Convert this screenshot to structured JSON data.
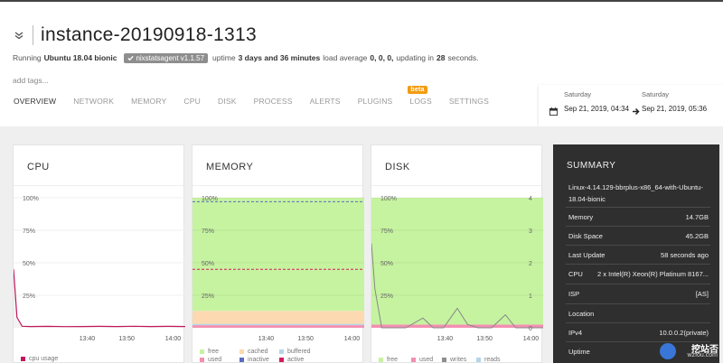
{
  "header": {
    "title": "instance-20190918-1313",
    "running_prefix": "Running",
    "os": "Ubuntu 18.04 bionic",
    "agent_badge": "nixstatsagent v1.1.57",
    "uptime_prefix": "uptime",
    "uptime_value": "3 days and 36 minutes",
    "load_prefix": "load average",
    "load_value": "0, 0, 0,",
    "updating_prefix": "updating in",
    "updating_value": "28",
    "updating_suffix": "seconds.",
    "add_tags": "add tags..."
  },
  "tabs": [
    {
      "label": "OVERVIEW",
      "active": true
    },
    {
      "label": "NETWORK"
    },
    {
      "label": "MEMORY"
    },
    {
      "label": "CPU"
    },
    {
      "label": "DISK"
    },
    {
      "label": "PROCESS"
    },
    {
      "label": "ALERTS"
    },
    {
      "label": "PLUGINS"
    },
    {
      "label": "LOGS",
      "badge": "beta"
    },
    {
      "label": "SETTINGS"
    }
  ],
  "date_range": {
    "from_day": "Saturday",
    "from_date": "Sep 21, 2019, 04:34",
    "to_day": "Saturday",
    "to_date": "Sep 21, 2019, 05:36"
  },
  "cards": {
    "cpu": {
      "title": "CPU",
      "legend": [
        "cpu usage"
      ]
    },
    "memory": {
      "title": "MEMORY",
      "legend": [
        "free",
        "cached",
        "buffered",
        "used",
        "inactive",
        "active"
      ]
    },
    "disk": {
      "title": "DISK",
      "legend": [
        "free",
        "used",
        "writes",
        "reads"
      ]
    }
  },
  "colors": {
    "cpu": "#c2185b",
    "free": "#c6f3a0",
    "cached": "#fcd9b0",
    "buffered": "#b3d6e8",
    "used": "#f48fb1",
    "inactive": "#5c6bc0",
    "active": "#d81b60",
    "writes": "#8e8e8e",
    "reads": "#b3d6e8",
    "summary_bg": "#2f2f2f",
    "badge_beta": "#f39c12"
  },
  "summary": {
    "title": "SUMMARY",
    "os_string": "Linux-4.14.129-bbrplus-x86_64-with-Ubuntu-18.04-bionic",
    "rows": [
      {
        "label": "Memory",
        "value": "14.7GB"
      },
      {
        "label": "Disk Space",
        "value": "45.2GB"
      },
      {
        "label": "Last Update",
        "value": "58 seconds ago"
      },
      {
        "label": "CPU",
        "value": "2 x Intel(R) Xeon(R) Platinum 8167..."
      },
      {
        "label": "ISP",
        "value": "[AS]"
      },
      {
        "label": "Location",
        "value": ""
      },
      {
        "label": "IPv4",
        "value": "10.0.0.2(private)"
      },
      {
        "label": "Uptime",
        "value": ""
      }
    ]
  },
  "watermark": {
    "text": "挖站否",
    "sub": "wzfou.com"
  },
  "chart_data": [
    {
      "type": "area",
      "title": "CPU",
      "x_ticks": [
        "13:40",
        "13:50",
        "14:00"
      ],
      "y_ticks": [
        "100%",
        "75%",
        "50%",
        "25%"
      ],
      "ylim": [
        0,
        100
      ],
      "x": [
        0,
        0.02,
        0.05,
        0.1,
        0.2,
        0.3,
        0.4,
        0.5,
        0.6,
        0.7,
        0.8,
        0.9,
        1.0
      ],
      "series": [
        {
          "name": "cpu usage",
          "values": [
            45,
            8,
            1.2,
            1.0,
            1.1,
            0.9,
            1.0,
            1.1,
            1.0,
            1.2,
            1.0,
            1.1,
            1.0
          ]
        }
      ]
    },
    {
      "type": "area",
      "title": "MEMORY",
      "x_ticks": [
        "13:40",
        "13:50",
        "14:00"
      ],
      "y_ticks": [
        "100%",
        "75%",
        "50%",
        "25%"
      ],
      "ylim": [
        0,
        100
      ],
      "stacked_bands": [
        {
          "name": "used",
          "from": 0,
          "to": 2
        },
        {
          "name": "buffered",
          "from": 2,
          "to": 3
        },
        {
          "name": "cached",
          "from": 3,
          "to": 13
        },
        {
          "name": "free",
          "from": 13,
          "to": 100
        }
      ],
      "lines": [
        {
          "name": "inactive",
          "value": 97
        },
        {
          "name": "active",
          "value": 45
        }
      ]
    },
    {
      "type": "line",
      "title": "DISK",
      "x_ticks": [
        "13:40",
        "13:50",
        "14:00"
      ],
      "y_ticks_left": [
        "100%",
        "75%",
        "50%",
        "25%"
      ],
      "y_ticks_right": [
        "4",
        "3",
        "2",
        "1",
        "0"
      ],
      "ylim_left": [
        0,
        100
      ],
      "ylim_right": [
        0,
        4
      ],
      "bands": [
        {
          "name": "used",
          "from": 0,
          "to": 2.5
        },
        {
          "name": "free",
          "from": 2.5,
          "to": 100
        }
      ],
      "x": [
        0,
        0.02,
        0.06,
        0.12,
        0.2,
        0.3,
        0.36,
        0.42,
        0.5,
        0.56,
        0.62,
        0.7,
        0.78,
        0.84,
        0.9,
        0.95,
        1.0
      ],
      "series": [
        {
          "name": "writes",
          "values": [
            2.6,
            1.2,
            0,
            0,
            0,
            0.3,
            0,
            0,
            0.6,
            0.1,
            0,
            0,
            0.4,
            0,
            0,
            0,
            0
          ]
        }
      ]
    }
  ]
}
